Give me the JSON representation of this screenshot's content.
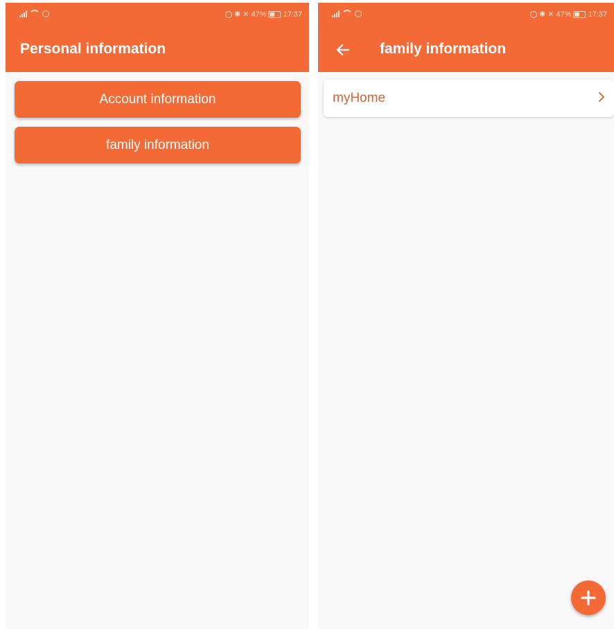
{
  "status": {
    "percent": "47%",
    "time": "17:37"
  },
  "left_screen": {
    "title": "Personal information",
    "buttons": [
      {
        "label": "Account information"
      },
      {
        "label": "family information"
      }
    ]
  },
  "right_screen": {
    "title": "family information",
    "items": [
      {
        "label": "myHome"
      }
    ]
  },
  "colors": {
    "accent": "#f46a36",
    "background": "#f8f8f8",
    "item_text": "#d9602f"
  },
  "icons": {
    "back": "arrow-left-icon",
    "item": "chevron-right-icon",
    "fab": "plus-icon"
  }
}
